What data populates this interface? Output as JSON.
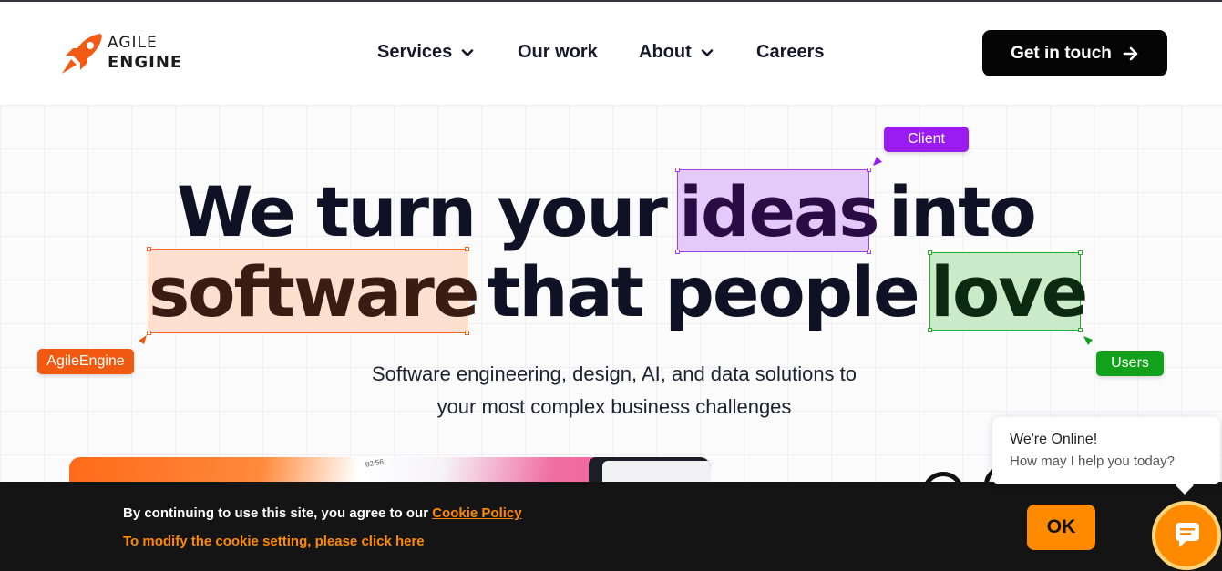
{
  "header": {
    "logo": {
      "line1": "AGILE",
      "line2": "ENGINE"
    },
    "nav": [
      {
        "label": "Services",
        "has_dropdown": true
      },
      {
        "label": "Our work",
        "has_dropdown": false
      },
      {
        "label": "About",
        "has_dropdown": true
      },
      {
        "label": "Careers",
        "has_dropdown": false
      }
    ],
    "cta_label": "Get in touch"
  },
  "hero": {
    "line1": {
      "pre": "We turn your",
      "highlight": "ideas",
      "post": "into"
    },
    "line2": {
      "highlight1": "software",
      "mid": "that people",
      "highlight2": "love"
    },
    "tags": {
      "client": "Client",
      "agileengine": "AgileEngine",
      "users": "Users"
    },
    "subtitle_line1": "Software engineering, design, AI, and data solutions to",
    "subtitle_line2": "your most complex business challenges",
    "media_time": "02:56"
  },
  "cookie_banner": {
    "text": "By continuing to use this site, you agree to our",
    "policy_link": "Cookie Policy",
    "modify_link": "To modify the cookie setting, please click here",
    "ok_label": "OK"
  },
  "chat": {
    "title": "We're Online!",
    "subtitle": "How may I help you today?"
  },
  "colors": {
    "brand_orange": "#ff8a00",
    "client_purple": "#9b1cf0",
    "agile_orange": "#f0590f",
    "users_green": "#12a11a"
  }
}
